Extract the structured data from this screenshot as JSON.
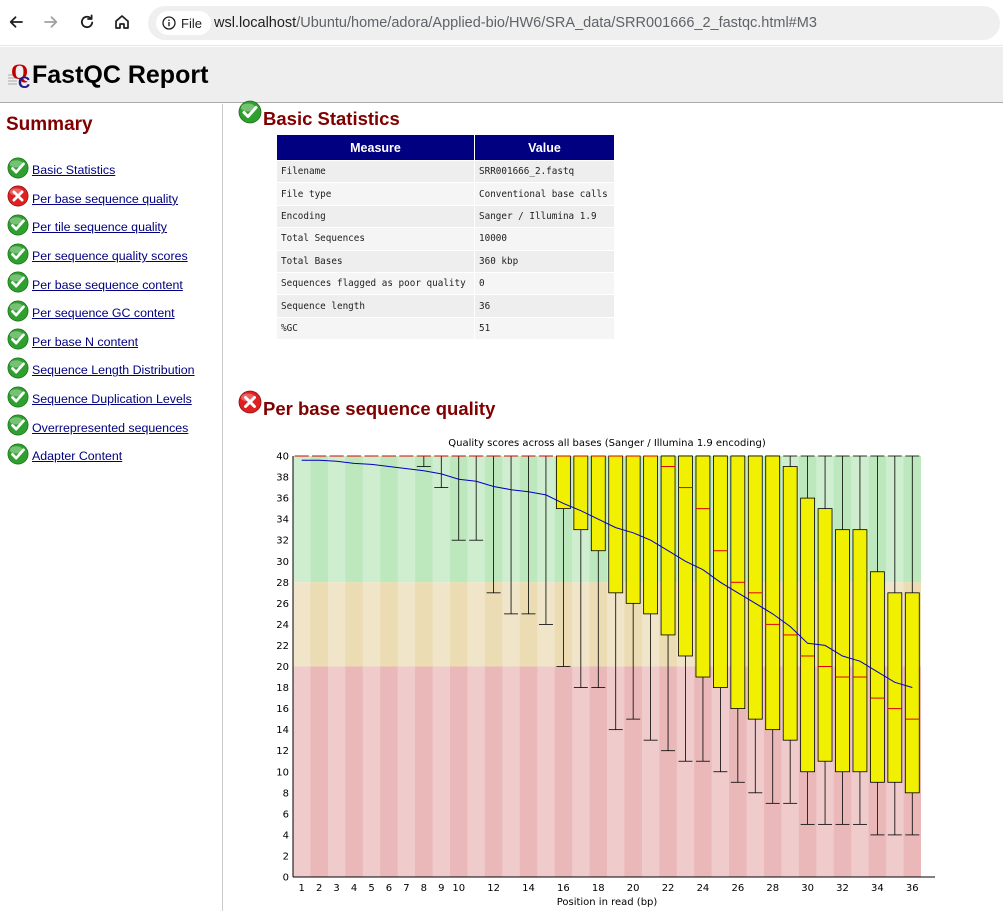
{
  "browser": {
    "url_chip_label": "File",
    "url_host": "wsl.localhost",
    "url_path": "/Ubuntu/home/adora/Applied-bio/HW6/SRA_data/SRR001666_2_fastqc.html#M3"
  },
  "report": {
    "title": "FastQC Report"
  },
  "summary": {
    "heading": "Summary",
    "items": [
      {
        "label": "Basic Statistics",
        "status": "pass"
      },
      {
        "label": "Per base sequence quality",
        "status": "fail"
      },
      {
        "label": "Per tile sequence quality",
        "status": "pass"
      },
      {
        "label": "Per sequence quality scores",
        "status": "pass"
      },
      {
        "label": "Per base sequence content",
        "status": "pass"
      },
      {
        "label": "Per sequence GC content",
        "status": "pass"
      },
      {
        "label": "Per base N content",
        "status": "pass"
      },
      {
        "label": "Sequence Length Distribution",
        "status": "pass"
      },
      {
        "label": "Sequence Duplication Levels",
        "status": "pass"
      },
      {
        "label": "Overrepresented sequences",
        "status": "pass"
      },
      {
        "label": "Adapter Content",
        "status": "pass"
      }
    ]
  },
  "basic_stats": {
    "heading": "Basic Statistics",
    "status": "pass",
    "columns": [
      "Measure",
      "Value"
    ],
    "rows": [
      [
        "Filename",
        "SRR001666_2.fastq"
      ],
      [
        "File type",
        "Conventional base calls"
      ],
      [
        "Encoding",
        "Sanger / Illumina 1.9"
      ],
      [
        "Total Sequences",
        "10000"
      ],
      [
        "Total Bases",
        "360 kbp"
      ],
      [
        "Sequences flagged as poor quality",
        "0"
      ],
      [
        "Sequence length",
        "36"
      ],
      [
        "%GC",
        "51"
      ]
    ]
  },
  "per_base_quality": {
    "heading": "Per base sequence quality",
    "status": "fail"
  },
  "colors": {
    "pass_green": "#2ea02e",
    "fail_red": "#e02020",
    "heading_maroon": "#800000",
    "link_navy": "#000080",
    "table_header": "#000080",
    "box_fill": "#f0f000",
    "median_line": "#e00000",
    "mean_line": "#0000c0",
    "zone_good": "#bde8bd",
    "zone_ok": "#ecdcb4",
    "zone_bad": "#eab8b8"
  },
  "chart_data": {
    "type": "box",
    "title": "Quality scores across all bases (Sanger / Illumina 1.9 encoding)",
    "xlabel": "Position in read (bp)",
    "ylabel": "",
    "ylim": [
      0,
      40
    ],
    "yticks": [
      0,
      2,
      4,
      6,
      8,
      10,
      12,
      14,
      16,
      18,
      20,
      22,
      24,
      26,
      28,
      30,
      32,
      34,
      36,
      38,
      40
    ],
    "xtick_labels": [
      "1",
      "2",
      "3",
      "4",
      "5",
      "6",
      "7",
      "8",
      "9",
      "10",
      "12",
      "14",
      "16",
      "18",
      "20",
      "22",
      "24",
      "26",
      "28",
      "30",
      "32",
      "34",
      "36"
    ],
    "zones": [
      {
        "from": 28,
        "to": 40,
        "label": "good"
      },
      {
        "from": 20,
        "to": 28,
        "label": "reasonable"
      },
      {
        "from": 0,
        "to": 20,
        "label": "poor"
      }
    ],
    "positions": [
      {
        "pos": 1,
        "lw": 40,
        "q1": 40,
        "median": 40,
        "q3": 40,
        "uw": 40,
        "mean": 39.6
      },
      {
        "pos": 2,
        "lw": 40,
        "q1": 40,
        "median": 40,
        "q3": 40,
        "uw": 40,
        "mean": 39.6
      },
      {
        "pos": 3,
        "lw": 40,
        "q1": 40,
        "median": 40,
        "q3": 40,
        "uw": 40,
        "mean": 39.5
      },
      {
        "pos": 4,
        "lw": 40,
        "q1": 40,
        "median": 40,
        "q3": 40,
        "uw": 40,
        "mean": 39.3
      },
      {
        "pos": 5,
        "lw": 40,
        "q1": 40,
        "median": 40,
        "q3": 40,
        "uw": 40,
        "mean": 39.2
      },
      {
        "pos": 6,
        "lw": 40,
        "q1": 40,
        "median": 40,
        "q3": 40,
        "uw": 40,
        "mean": 39.0
      },
      {
        "pos": 7,
        "lw": 40,
        "q1": 40,
        "median": 40,
        "q3": 40,
        "uw": 40,
        "mean": 38.8
      },
      {
        "pos": 8,
        "lw": 39,
        "q1": 40,
        "median": 40,
        "q3": 40,
        "uw": 40,
        "mean": 38.6
      },
      {
        "pos": 9,
        "lw": 37,
        "q1": 40,
        "median": 40,
        "q3": 40,
        "uw": 40,
        "mean": 38.3
      },
      {
        "pos": 10,
        "lw": 32,
        "q1": 40,
        "median": 40,
        "q3": 40,
        "uw": 40,
        "mean": 37.8
      },
      {
        "pos": 11,
        "lw": 32,
        "q1": 40,
        "median": 40,
        "q3": 40,
        "uw": 40,
        "mean": 37.6
      },
      {
        "pos": 12,
        "lw": 27,
        "q1": 40,
        "median": 40,
        "q3": 40,
        "uw": 40,
        "mean": 37.1
      },
      {
        "pos": 13,
        "lw": 25,
        "q1": 40,
        "median": 40,
        "q3": 40,
        "uw": 40,
        "mean": 36.8
      },
      {
        "pos": 14,
        "lw": 25,
        "q1": 40,
        "median": 40,
        "q3": 40,
        "uw": 40,
        "mean": 36.6
      },
      {
        "pos": 15,
        "lw": 24,
        "q1": 40,
        "median": 40,
        "q3": 40,
        "uw": 40,
        "mean": 36.3
      },
      {
        "pos": 16,
        "lw": 20,
        "q1": 35,
        "median": 40,
        "q3": 40,
        "uw": 40,
        "mean": 35.5
      },
      {
        "pos": 17,
        "lw": 18,
        "q1": 33,
        "median": 40,
        "q3": 40,
        "uw": 40,
        "mean": 34.8
      },
      {
        "pos": 18,
        "lw": 18,
        "q1": 31,
        "median": 40,
        "q3": 40,
        "uw": 40,
        "mean": 34.0
      },
      {
        "pos": 19,
        "lw": 14,
        "q1": 27,
        "median": 40,
        "q3": 40,
        "uw": 40,
        "mean": 33.2
      },
      {
        "pos": 20,
        "lw": 15,
        "q1": 26,
        "median": 40,
        "q3": 40,
        "uw": 40,
        "mean": 32.7
      },
      {
        "pos": 21,
        "lw": 13,
        "q1": 25,
        "median": 40,
        "q3": 40,
        "uw": 40,
        "mean": 32.0
      },
      {
        "pos": 22,
        "lw": 12,
        "q1": 23,
        "median": 39,
        "q3": 40,
        "uw": 40,
        "mean": 31.0
      },
      {
        "pos": 23,
        "lw": 11,
        "q1": 21,
        "median": 37,
        "q3": 40,
        "uw": 40,
        "mean": 30.0
      },
      {
        "pos": 24,
        "lw": 11,
        "q1": 19,
        "median": 35,
        "q3": 40,
        "uw": 40,
        "mean": 29.2
      },
      {
        "pos": 25,
        "lw": 10,
        "q1": 18,
        "median": 31,
        "q3": 40,
        "uw": 40,
        "mean": 28.0
      },
      {
        "pos": 26,
        "lw": 9,
        "q1": 16,
        "median": 28,
        "q3": 40,
        "uw": 40,
        "mean": 27.0
      },
      {
        "pos": 27,
        "lw": 8,
        "q1": 15,
        "median": 27,
        "q3": 40,
        "uw": 40,
        "mean": 26.0
      },
      {
        "pos": 28,
        "lw": 7,
        "q1": 14,
        "median": 24,
        "q3": 40,
        "uw": 40,
        "mean": 25.0
      },
      {
        "pos": 29,
        "lw": 7,
        "q1": 13,
        "median": 23,
        "q3": 39,
        "uw": 40,
        "mean": 23.8
      },
      {
        "pos": 30,
        "lw": 5,
        "q1": 10,
        "median": 21,
        "q3": 36,
        "uw": 40,
        "mean": 22.2
      },
      {
        "pos": 31,
        "lw": 5,
        "q1": 11,
        "median": 20,
        "q3": 35,
        "uw": 40,
        "mean": 22.0
      },
      {
        "pos": 32,
        "lw": 5,
        "q1": 10,
        "median": 19,
        "q3": 33,
        "uw": 40,
        "mean": 21.0
      },
      {
        "pos": 33,
        "lw": 5,
        "q1": 10,
        "median": 19,
        "q3": 33,
        "uw": 40,
        "mean": 20.5
      },
      {
        "pos": 34,
        "lw": 4,
        "q1": 9,
        "median": 17,
        "q3": 29,
        "uw": 40,
        "mean": 19.5
      },
      {
        "pos": 35,
        "lw": 4,
        "q1": 9,
        "median": 16,
        "q3": 27,
        "uw": 40,
        "mean": 18.5
      },
      {
        "pos": 36,
        "lw": 4,
        "q1": 8,
        "median": 15,
        "q3": 27,
        "uw": 40,
        "mean": 18.0
      }
    ]
  }
}
